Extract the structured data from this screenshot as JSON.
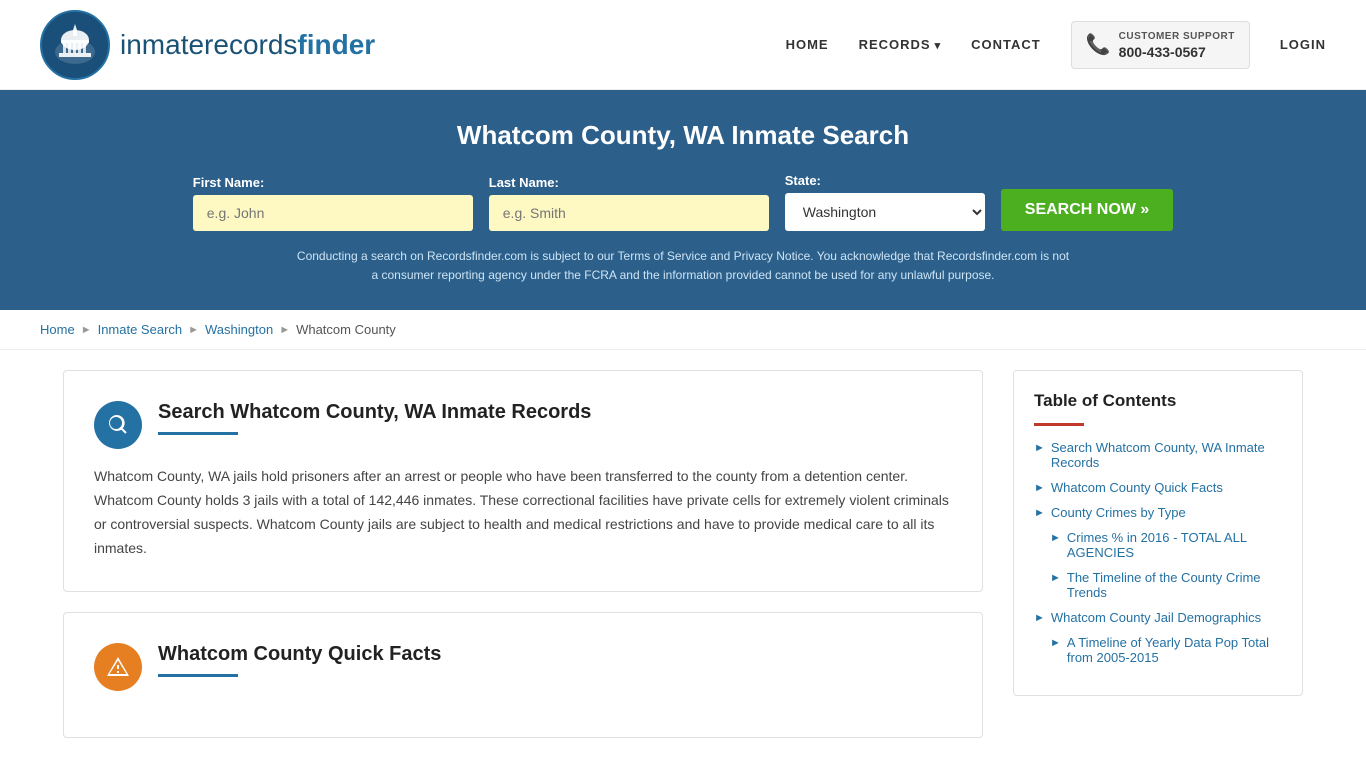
{
  "header": {
    "logo_text_normal": "inmaterecords",
    "logo_text_bold": "finder",
    "nav": {
      "home": "HOME",
      "records": "RECORDS",
      "contact": "CONTACT",
      "support_label": "CUSTOMER SUPPORT",
      "support_number": "800-433-0567",
      "login": "LOGIN"
    }
  },
  "hero": {
    "title": "Whatcom County, WA Inmate Search",
    "first_name_label": "First Name:",
    "first_name_placeholder": "e.g. John",
    "last_name_label": "Last Name:",
    "last_name_placeholder": "e.g. Smith",
    "state_label": "State:",
    "state_value": "Washington",
    "search_btn": "SEARCH NOW »",
    "disclaimer": "Conducting a search on Recordsfinder.com is subject to our Terms of Service and Privacy Notice. You acknowledge that Recordsfinder.com is not a consumer reporting agency under the FCRA and the information provided cannot be used for any unlawful purpose."
  },
  "breadcrumb": {
    "home": "Home",
    "inmate_search": "Inmate Search",
    "washington": "Washington",
    "current": "Whatcom County"
  },
  "main_card": {
    "title": "Search Whatcom County, WA Inmate Records",
    "body": "Whatcom County, WA jails hold prisoners after an arrest or people who have been transferred to the county from a detention center. Whatcom County holds 3 jails with a total of 142,446 inmates. These correctional facilities have private cells for extremely violent criminals or controversial suspects. Whatcom County jails are subject to health and medical restrictions and have to provide medical care to all its inmates."
  },
  "quick_facts_card": {
    "title": "Whatcom County Quick Facts"
  },
  "toc": {
    "title": "Table of Contents",
    "items": [
      {
        "label": "Search Whatcom County, WA Inmate Records",
        "sub": false
      },
      {
        "label": "Whatcom County Quick Facts",
        "sub": false
      },
      {
        "label": "County Crimes by Type",
        "sub": false
      },
      {
        "label": "Crimes % in 2016 - TOTAL ALL AGENCIES",
        "sub": true
      },
      {
        "label": "The Timeline of the County Crime Trends",
        "sub": true
      },
      {
        "label": "Whatcom County Jail Demographics",
        "sub": false
      },
      {
        "label": "A Timeline of Yearly Data Pop Total from 2005-2015",
        "sub": true
      }
    ]
  }
}
